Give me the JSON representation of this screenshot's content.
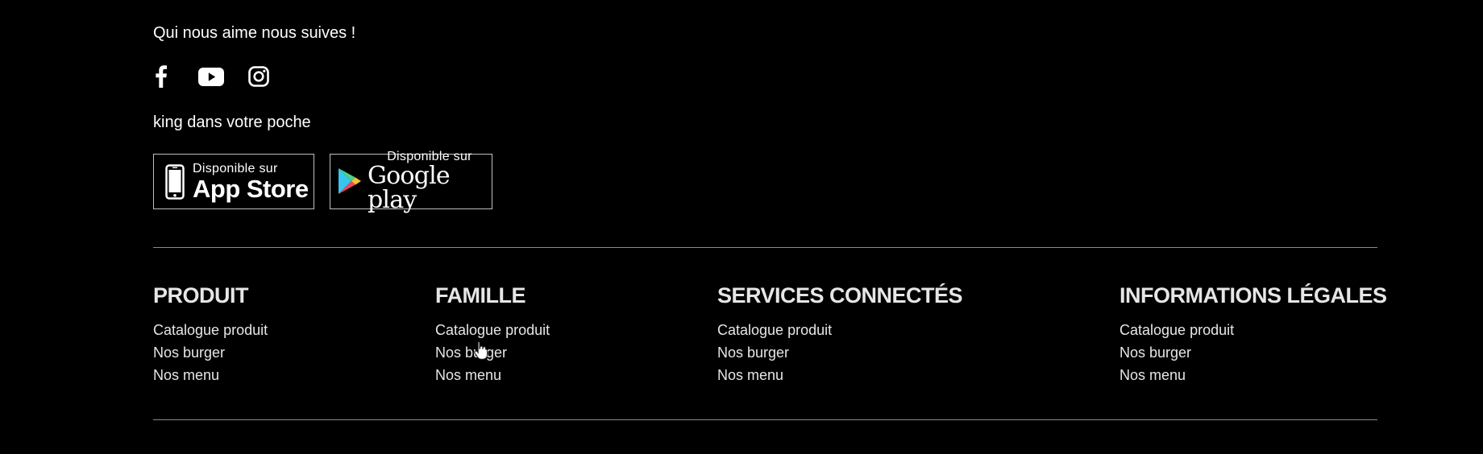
{
  "follow": {
    "text": "Qui nous aime nous suives !",
    "icons": [
      "facebook-icon",
      "youtube-icon",
      "instagram-icon"
    ]
  },
  "pocket": {
    "text": "king dans votre poche"
  },
  "stores": {
    "apple": {
      "small": "Disponible sur",
      "big": "App Store"
    },
    "google": {
      "small": "Disponible sur",
      "big": "Google play"
    }
  },
  "columns": [
    {
      "title": "PRODUIT",
      "links": [
        "Catalogue produit",
        "Nos burger",
        "Nos menu"
      ]
    },
    {
      "title": "FAMILLE",
      "links": [
        "Catalogue produit",
        "Nos burger",
        "Nos menu"
      ]
    },
    {
      "title": "SERVICES CONNECTÉS",
      "links": [
        "Catalogue produit",
        "Nos burger",
        "Nos menu"
      ]
    },
    {
      "title": "INFORMATIONS LÉGALES",
      "links": [
        "Catalogue produit",
        "Nos burger",
        "Nos menu"
      ]
    }
  ],
  "colors": {
    "background": "#000000",
    "text": "#ffffff",
    "muted_text": "#e6e6e6",
    "divider": "#8a8a8a"
  }
}
